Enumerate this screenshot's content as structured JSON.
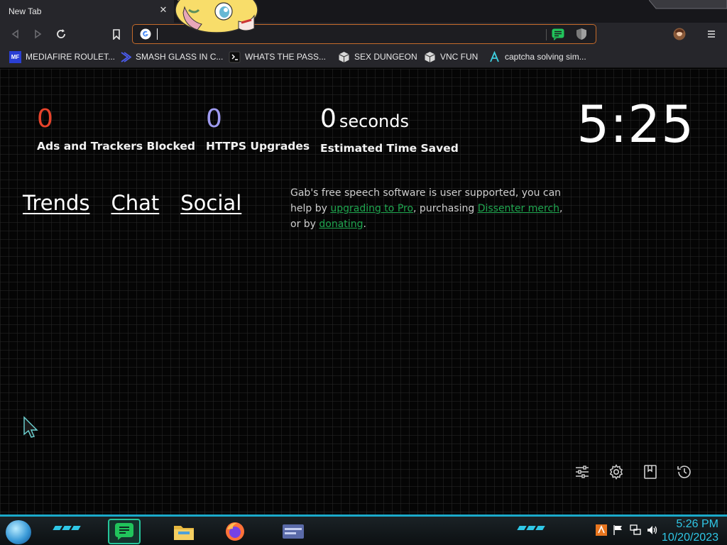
{
  "tab": {
    "title": "New Tab",
    "close_icon": "close-icon"
  },
  "omnibox": {
    "value": ""
  },
  "bookmarks": [
    {
      "label": "MEDIAFIRE ROULET...",
      "icon": "mediafire-icon"
    },
    {
      "label": "SMASH GLASS IN C...",
      "icon": "bracket-icon"
    },
    {
      "label": "WHATS THE PASS...",
      "icon": "terminal-icon"
    },
    {
      "label": "SEX DUNGEON",
      "icon": "cube-icon"
    },
    {
      "label": "VNC FUN",
      "icon": "cube-icon"
    },
    {
      "label": "captcha solving sim...",
      "icon": "lambda-icon"
    }
  ],
  "stats": {
    "ads": {
      "value": "0",
      "label": "Ads and Trackers Blocked",
      "color": "#e8432b"
    },
    "https": {
      "value": "0",
      "label": "HTTPS Upgrades",
      "color": "#9f9bf0"
    },
    "time": {
      "value": "0",
      "unit": "seconds",
      "label": "Estimated Time Saved",
      "color": "#ffffff"
    }
  },
  "clock": "5:25",
  "links": {
    "trends": "Trends",
    "chat": "Chat",
    "social": "Social"
  },
  "gab": {
    "text1": "Gab's free speech software is user supported, you can help by ",
    "link1": "upgrading to Pro",
    "text2": ", purchasing ",
    "link2": "Dissenter merch",
    "text3": ", or by ",
    "link3": "donating",
    "text4": "."
  },
  "taskbar": {
    "time": "5:26 PM",
    "date": "10/20/2023",
    "accent": "#2fc7e6"
  }
}
